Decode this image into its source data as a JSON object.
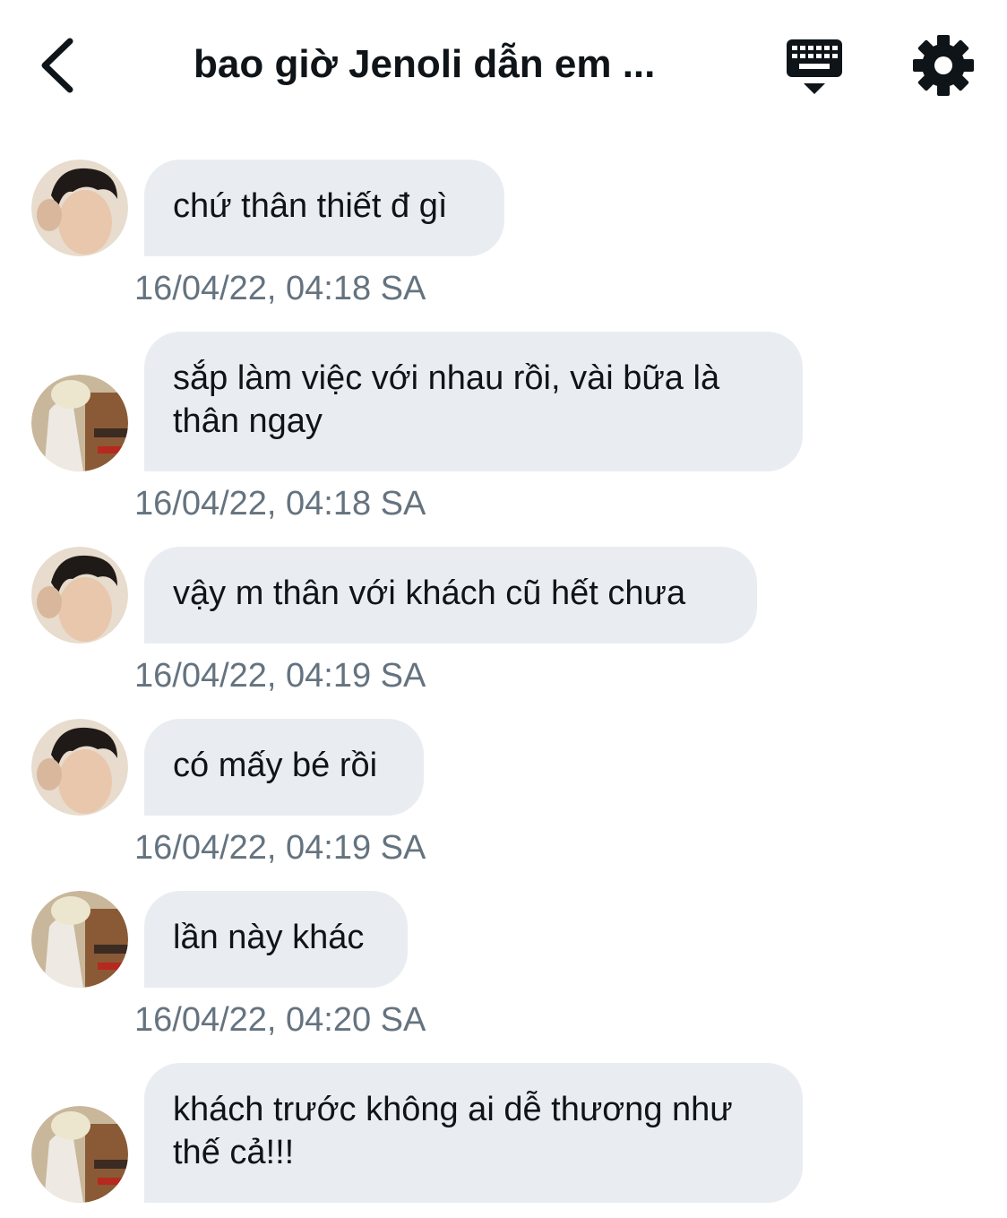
{
  "header": {
    "title": "bao giờ Jenoli dẫn em ...",
    "back_icon": "chevron-left-icon",
    "keyboard_icon": "keyboard-icon",
    "settings_icon": "gear-icon"
  },
  "colors": {
    "bubble_bg": "#e9edf1",
    "timestamp": "#64737f",
    "text": "#0f1419"
  },
  "messages": [
    {
      "avatar": "avatar-dark-hair",
      "text": "chứ thân thiết đ gì",
      "time": "16/04/22, 04:18 SA"
    },
    {
      "avatar": "avatar-blond-hair",
      "text": "sắp làm việc với nhau rồi, vài bữa là thân ngay",
      "time": "16/04/22, 04:18 SA"
    },
    {
      "avatar": "avatar-dark-hair",
      "text": "vậy m thân với khách cũ hết chưa",
      "time": "16/04/22, 04:19 SA"
    },
    {
      "avatar": "avatar-dark-hair",
      "text": "có mấy bé rồi",
      "time": "16/04/22, 04:19 SA"
    },
    {
      "avatar": "avatar-blond-hair",
      "text": "lần này khác",
      "time": "16/04/22, 04:20 SA"
    },
    {
      "avatar": "avatar-blond-hair",
      "text": "khách trước không ai dễ thương như thế cả!!!",
      "time": ""
    }
  ]
}
